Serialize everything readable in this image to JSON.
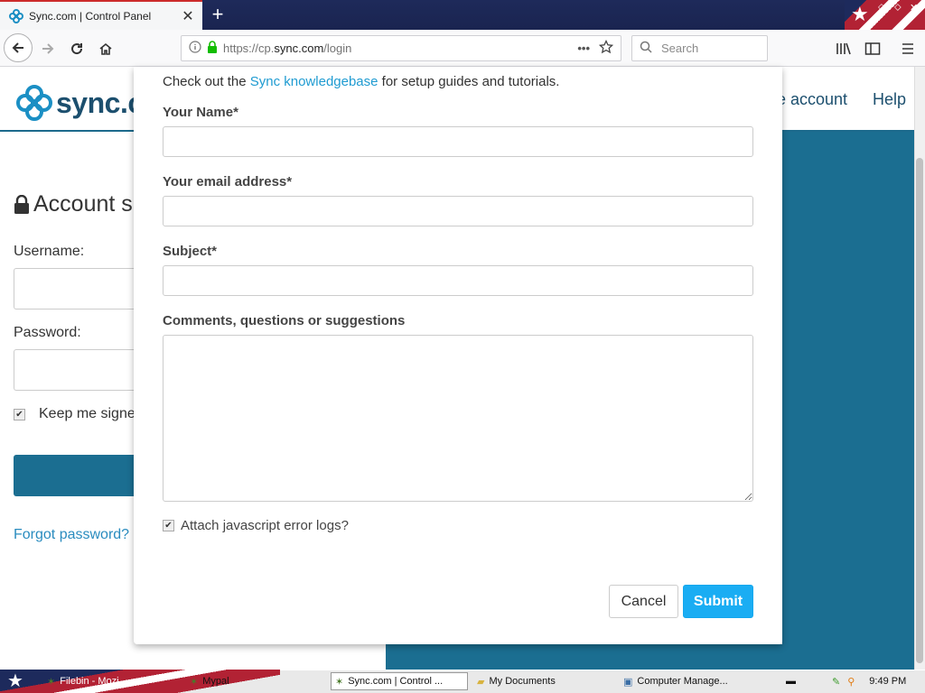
{
  "browser": {
    "tab_title": "Sync.com | Control Panel",
    "url_prefix": "https://cp.",
    "url_host": "sync.com",
    "url_path": "/login",
    "search_placeholder": "Search"
  },
  "page": {
    "logo_text": "sync.c",
    "nav": [
      {
        "label": "e account"
      },
      {
        "label": "Help"
      }
    ],
    "title": "Account si",
    "username_label": "Username:",
    "password_label": "Password:",
    "keep_signed": "Keep me signed",
    "forgot": "Forgot password?"
  },
  "modal": {
    "intro_prefix": "Check out the ",
    "intro_link": "Sync knowledgebase",
    "intro_suffix": " for setup guides and tutorials.",
    "fields": {
      "name": {
        "label": "Your Name*",
        "value": ""
      },
      "email": {
        "label": "Your email address*",
        "value": ""
      },
      "subject": {
        "label": "Subject*",
        "value": ""
      },
      "comments": {
        "label": "Comments, questions or suggestions",
        "value": ""
      }
    },
    "attach_label": "Attach javascript error logs?",
    "attach_checked": true,
    "cancel_label": "Cancel",
    "submit_label": "Submit"
  },
  "taskbar": {
    "items": [
      {
        "label": "Filebin - Mozi"
      },
      {
        "label": "Mypal"
      },
      {
        "label": "Sync.com | Control ..."
      },
      {
        "label": "My Documents"
      },
      {
        "label": "Computer Manage..."
      }
    ],
    "clock": "9:49 PM"
  },
  "colors": {
    "accent": "#1aadf3",
    "link": "#1f9bd1",
    "page_blue": "#1b6e91"
  }
}
